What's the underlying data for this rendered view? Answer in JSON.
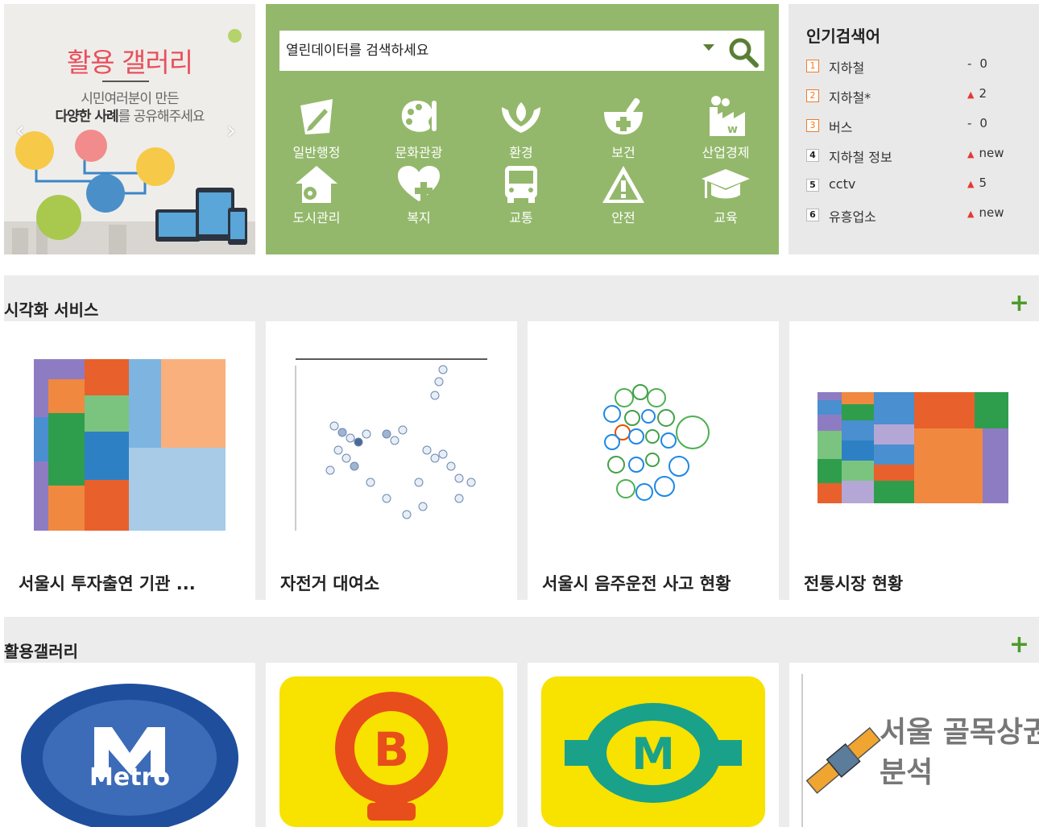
{
  "banner": {
    "title": "활용 갤러리",
    "line1": "시민여러분이 만든",
    "line2_bold": "다양한 사례",
    "line2_rest": "를 공유해주세요"
  },
  "search": {
    "placeholder": "열린데이터를 검색하세요"
  },
  "categories": [
    {
      "label": "일반행정",
      "icon": "pencil-doc-icon"
    },
    {
      "label": "문화관광",
      "icon": "palette-icon"
    },
    {
      "label": "환경",
      "icon": "hands-leaf-icon"
    },
    {
      "label": "보건",
      "icon": "mortar-cross-icon"
    },
    {
      "label": "산업경제",
      "icon": "factory-icon"
    },
    {
      "label": "도시관리",
      "icon": "house-gear-icon"
    },
    {
      "label": "복지",
      "icon": "heart-plus-icon"
    },
    {
      "label": "교통",
      "icon": "bus-icon"
    },
    {
      "label": "안전",
      "icon": "warning-icon"
    },
    {
      "label": "교육",
      "icon": "grad-cap-icon"
    }
  ],
  "popular": {
    "title": "인기검색어",
    "items": [
      {
        "rank": "1",
        "word": "지하철",
        "trend": "same",
        "change": "0"
      },
      {
        "rank": "2",
        "word": "지하철*",
        "trend": "up",
        "change": "2"
      },
      {
        "rank": "3",
        "word": "버스",
        "trend": "same",
        "change": "0"
      },
      {
        "rank": "4",
        "word": "지하철 정보",
        "trend": "up",
        "change": "new"
      },
      {
        "rank": "5",
        "word": "cctv",
        "trend": "up",
        "change": "5"
      },
      {
        "rank": "6",
        "word": "유흥업소",
        "trend": "up",
        "change": "new"
      }
    ]
  },
  "viz": {
    "title": "시각화 서비스",
    "more": "+",
    "cards": [
      {
        "caption": "서울시 투자출연 기관 ..."
      },
      {
        "caption": "자전거 대여소"
      },
      {
        "caption": "서울시 음주운전 사고 현황"
      },
      {
        "caption": "전통시장 현황"
      }
    ]
  },
  "gallery": {
    "title": "활용갤러리",
    "more": "+",
    "cards": [
      {
        "logo": "Metro"
      },
      {
        "logo": "B"
      },
      {
        "logo": "M"
      },
      {
        "logo_line1": "서울 골목상권",
        "logo_line2": "분석"
      }
    ]
  },
  "colors": {
    "green_panel": "#93b86b",
    "accent_red": "#e8505b",
    "plus_green": "#4c9a2a"
  }
}
